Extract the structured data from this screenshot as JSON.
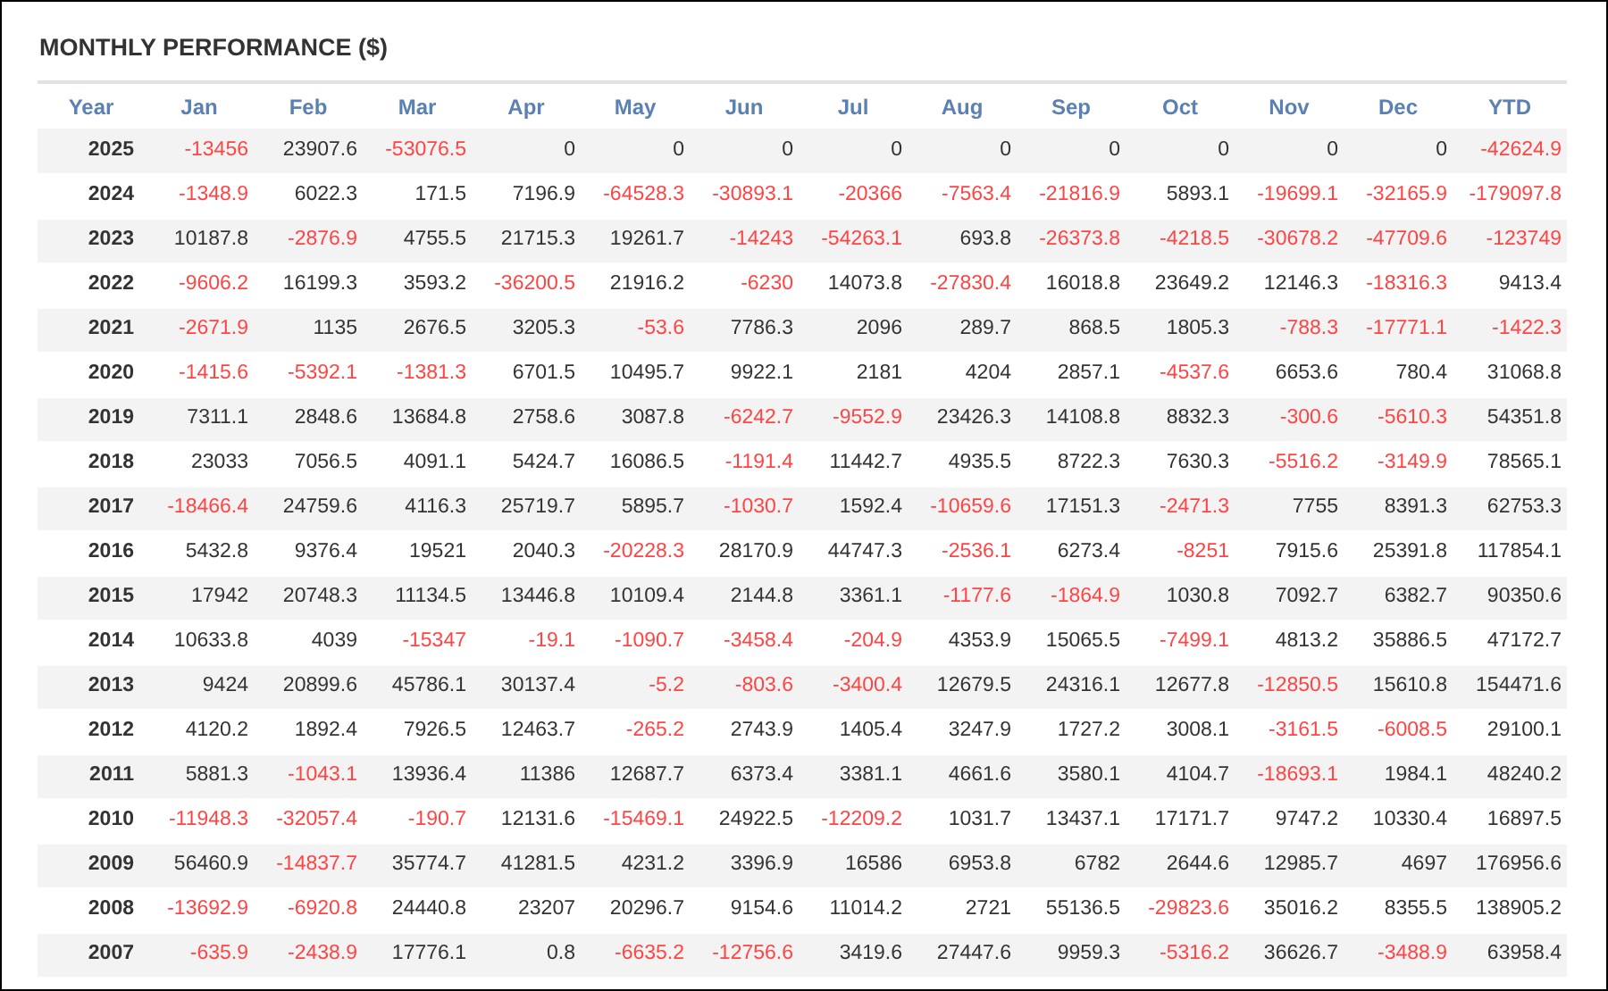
{
  "title": "MONTHLY PERFORMANCE ($)",
  "columns": [
    "Year",
    "Jan",
    "Feb",
    "Mar",
    "Apr",
    "May",
    "Jun",
    "Jul",
    "Aug",
    "Sep",
    "Oct",
    "Nov",
    "Dec",
    "YTD"
  ],
  "rows": [
    {
      "year": "2025",
      "cells": [
        {
          "value": "-13456",
          "negative": true
        },
        {
          "value": "23907.6",
          "negative": false
        },
        {
          "value": "-53076.5",
          "negative": true
        },
        {
          "value": "0",
          "negative": false
        },
        {
          "value": "0",
          "negative": false
        },
        {
          "value": "0",
          "negative": false
        },
        {
          "value": "0",
          "negative": false
        },
        {
          "value": "0",
          "negative": false
        },
        {
          "value": "0",
          "negative": false
        },
        {
          "value": "0",
          "negative": false
        },
        {
          "value": "0",
          "negative": false
        },
        {
          "value": "0",
          "negative": false
        },
        {
          "value": "-42624.9",
          "negative": true
        }
      ]
    },
    {
      "year": "2024",
      "cells": [
        {
          "value": "-1348.9",
          "negative": true
        },
        {
          "value": "6022.3",
          "negative": false
        },
        {
          "value": "171.5",
          "negative": false
        },
        {
          "value": "7196.9",
          "negative": false
        },
        {
          "value": "-64528.3",
          "negative": true
        },
        {
          "value": "-30893.1",
          "negative": true
        },
        {
          "value": "-20366",
          "negative": true
        },
        {
          "value": "-7563.4",
          "negative": true
        },
        {
          "value": "-21816.9",
          "negative": true
        },
        {
          "value": "5893.1",
          "negative": false
        },
        {
          "value": "-19699.1",
          "negative": true
        },
        {
          "value": "-32165.9",
          "negative": true
        },
        {
          "value": "-179097.8",
          "negative": true
        }
      ]
    },
    {
      "year": "2023",
      "cells": [
        {
          "value": "10187.8",
          "negative": false
        },
        {
          "value": "-2876.9",
          "negative": true
        },
        {
          "value": "4755.5",
          "negative": false
        },
        {
          "value": "21715.3",
          "negative": false
        },
        {
          "value": "19261.7",
          "negative": false
        },
        {
          "value": "-14243",
          "negative": true
        },
        {
          "value": "-54263.1",
          "negative": true
        },
        {
          "value": "693.8",
          "negative": false
        },
        {
          "value": "-26373.8",
          "negative": true
        },
        {
          "value": "-4218.5",
          "negative": true
        },
        {
          "value": "-30678.2",
          "negative": true
        },
        {
          "value": "-47709.6",
          "negative": true
        },
        {
          "value": "-123749",
          "negative": true
        }
      ]
    },
    {
      "year": "2022",
      "cells": [
        {
          "value": "-9606.2",
          "negative": true
        },
        {
          "value": "16199.3",
          "negative": false
        },
        {
          "value": "3593.2",
          "negative": false
        },
        {
          "value": "-36200.5",
          "negative": true
        },
        {
          "value": "21916.2",
          "negative": false
        },
        {
          "value": "-6230",
          "negative": true
        },
        {
          "value": "14073.8",
          "negative": false
        },
        {
          "value": "-27830.4",
          "negative": true
        },
        {
          "value": "16018.8",
          "negative": false
        },
        {
          "value": "23649.2",
          "negative": false
        },
        {
          "value": "12146.3",
          "negative": false
        },
        {
          "value": "-18316.3",
          "negative": true
        },
        {
          "value": "9413.4",
          "negative": false
        }
      ]
    },
    {
      "year": "2021",
      "cells": [
        {
          "value": "-2671.9",
          "negative": true
        },
        {
          "value": "1135",
          "negative": false
        },
        {
          "value": "2676.5",
          "negative": false
        },
        {
          "value": "3205.3",
          "negative": false
        },
        {
          "value": "-53.6",
          "negative": true
        },
        {
          "value": "7786.3",
          "negative": false
        },
        {
          "value": "2096",
          "negative": false
        },
        {
          "value": "289.7",
          "negative": false
        },
        {
          "value": "868.5",
          "negative": false
        },
        {
          "value": "1805.3",
          "negative": false
        },
        {
          "value": "-788.3",
          "negative": true
        },
        {
          "value": "-17771.1",
          "negative": true
        },
        {
          "value": "-1422.3",
          "negative": true
        }
      ]
    },
    {
      "year": "2020",
      "cells": [
        {
          "value": "-1415.6",
          "negative": true
        },
        {
          "value": "-5392.1",
          "negative": true
        },
        {
          "value": "-1381.3",
          "negative": true
        },
        {
          "value": "6701.5",
          "negative": false
        },
        {
          "value": "10495.7",
          "negative": false
        },
        {
          "value": "9922.1",
          "negative": false
        },
        {
          "value": "2181",
          "negative": false
        },
        {
          "value": "4204",
          "negative": false
        },
        {
          "value": "2857.1",
          "negative": false
        },
        {
          "value": "-4537.6",
          "negative": true
        },
        {
          "value": "6653.6",
          "negative": false
        },
        {
          "value": "780.4",
          "negative": false
        },
        {
          "value": "31068.8",
          "negative": false
        }
      ]
    },
    {
      "year": "2019",
      "cells": [
        {
          "value": "7311.1",
          "negative": false
        },
        {
          "value": "2848.6",
          "negative": false
        },
        {
          "value": "13684.8",
          "negative": false
        },
        {
          "value": "2758.6",
          "negative": false
        },
        {
          "value": "3087.8",
          "negative": false
        },
        {
          "value": "-6242.7",
          "negative": true
        },
        {
          "value": "-9552.9",
          "negative": true
        },
        {
          "value": "23426.3",
          "negative": false
        },
        {
          "value": "14108.8",
          "negative": false
        },
        {
          "value": "8832.3",
          "negative": false
        },
        {
          "value": "-300.6",
          "negative": true
        },
        {
          "value": "-5610.3",
          "negative": true
        },
        {
          "value": "54351.8",
          "negative": false
        }
      ]
    },
    {
      "year": "2018",
      "cells": [
        {
          "value": "23033",
          "negative": false
        },
        {
          "value": "7056.5",
          "negative": false
        },
        {
          "value": "4091.1",
          "negative": false
        },
        {
          "value": "5424.7",
          "negative": false
        },
        {
          "value": "16086.5",
          "negative": false
        },
        {
          "value": "-1191.4",
          "negative": true
        },
        {
          "value": "11442.7",
          "negative": false
        },
        {
          "value": "4935.5",
          "negative": false
        },
        {
          "value": "8722.3",
          "negative": false
        },
        {
          "value": "7630.3",
          "negative": false
        },
        {
          "value": "-5516.2",
          "negative": true
        },
        {
          "value": "-3149.9",
          "negative": true
        },
        {
          "value": "78565.1",
          "negative": false
        }
      ]
    },
    {
      "year": "2017",
      "cells": [
        {
          "value": "-18466.4",
          "negative": true
        },
        {
          "value": "24759.6",
          "negative": false
        },
        {
          "value": "4116.3",
          "negative": false
        },
        {
          "value": "25719.7",
          "negative": false
        },
        {
          "value": "5895.7",
          "negative": false
        },
        {
          "value": "-1030.7",
          "negative": true
        },
        {
          "value": "1592.4",
          "negative": false
        },
        {
          "value": "-10659.6",
          "negative": true
        },
        {
          "value": "17151.3",
          "negative": false
        },
        {
          "value": "-2471.3",
          "negative": true
        },
        {
          "value": "7755",
          "negative": false
        },
        {
          "value": "8391.3",
          "negative": false
        },
        {
          "value": "62753.3",
          "negative": false
        }
      ]
    },
    {
      "year": "2016",
      "cells": [
        {
          "value": "5432.8",
          "negative": false
        },
        {
          "value": "9376.4",
          "negative": false
        },
        {
          "value": "19521",
          "negative": false
        },
        {
          "value": "2040.3",
          "negative": false
        },
        {
          "value": "-20228.3",
          "negative": true
        },
        {
          "value": "28170.9",
          "negative": false
        },
        {
          "value": "44747.3",
          "negative": false
        },
        {
          "value": "-2536.1",
          "negative": true
        },
        {
          "value": "6273.4",
          "negative": false
        },
        {
          "value": "-8251",
          "negative": true
        },
        {
          "value": "7915.6",
          "negative": false
        },
        {
          "value": "25391.8",
          "negative": false
        },
        {
          "value": "117854.1",
          "negative": false
        }
      ]
    },
    {
      "year": "2015",
      "cells": [
        {
          "value": "17942",
          "negative": false
        },
        {
          "value": "20748.3",
          "negative": false
        },
        {
          "value": "11134.5",
          "negative": false
        },
        {
          "value": "13446.8",
          "negative": false
        },
        {
          "value": "10109.4",
          "negative": false
        },
        {
          "value": "2144.8",
          "negative": false
        },
        {
          "value": "3361.1",
          "negative": false
        },
        {
          "value": "-1177.6",
          "negative": true
        },
        {
          "value": "-1864.9",
          "negative": true
        },
        {
          "value": "1030.8",
          "negative": false
        },
        {
          "value": "7092.7",
          "negative": false
        },
        {
          "value": "6382.7",
          "negative": false
        },
        {
          "value": "90350.6",
          "negative": false
        }
      ]
    },
    {
      "year": "2014",
      "cells": [
        {
          "value": "10633.8",
          "negative": false
        },
        {
          "value": "4039",
          "negative": false
        },
        {
          "value": "-15347",
          "negative": true
        },
        {
          "value": "-19.1",
          "negative": true
        },
        {
          "value": "-1090.7",
          "negative": true
        },
        {
          "value": "-3458.4",
          "negative": true
        },
        {
          "value": "-204.9",
          "negative": true
        },
        {
          "value": "4353.9",
          "negative": false
        },
        {
          "value": "15065.5",
          "negative": false
        },
        {
          "value": "-7499.1",
          "negative": true
        },
        {
          "value": "4813.2",
          "negative": false
        },
        {
          "value": "35886.5",
          "negative": false
        },
        {
          "value": "47172.7",
          "negative": false
        }
      ]
    },
    {
      "year": "2013",
      "cells": [
        {
          "value": "9424",
          "negative": false
        },
        {
          "value": "20899.6",
          "negative": false
        },
        {
          "value": "45786.1",
          "negative": false
        },
        {
          "value": "30137.4",
          "negative": false
        },
        {
          "value": "-5.2",
          "negative": true
        },
        {
          "value": "-803.6",
          "negative": true
        },
        {
          "value": "-3400.4",
          "negative": true
        },
        {
          "value": "12679.5",
          "negative": false
        },
        {
          "value": "24316.1",
          "negative": false
        },
        {
          "value": "12677.8",
          "negative": false
        },
        {
          "value": "-12850.5",
          "negative": true
        },
        {
          "value": "15610.8",
          "negative": false
        },
        {
          "value": "154471.6",
          "negative": false
        }
      ]
    },
    {
      "year": "2012",
      "cells": [
        {
          "value": "4120.2",
          "negative": false
        },
        {
          "value": "1892.4",
          "negative": false
        },
        {
          "value": "7926.5",
          "negative": false
        },
        {
          "value": "12463.7",
          "negative": false
        },
        {
          "value": "-265.2",
          "negative": true
        },
        {
          "value": "2743.9",
          "negative": false
        },
        {
          "value": "1405.4",
          "negative": false
        },
        {
          "value": "3247.9",
          "negative": false
        },
        {
          "value": "1727.2",
          "negative": false
        },
        {
          "value": "3008.1",
          "negative": false
        },
        {
          "value": "-3161.5",
          "negative": true
        },
        {
          "value": "-6008.5",
          "negative": true
        },
        {
          "value": "29100.1",
          "negative": false
        }
      ]
    },
    {
      "year": "2011",
      "cells": [
        {
          "value": "5881.3",
          "negative": false
        },
        {
          "value": "-1043.1",
          "negative": true
        },
        {
          "value": "13936.4",
          "negative": false
        },
        {
          "value": "11386",
          "negative": false
        },
        {
          "value": "12687.7",
          "negative": false
        },
        {
          "value": "6373.4",
          "negative": false
        },
        {
          "value": "3381.1",
          "negative": false
        },
        {
          "value": "4661.6",
          "negative": false
        },
        {
          "value": "3580.1",
          "negative": false
        },
        {
          "value": "4104.7",
          "negative": false
        },
        {
          "value": "-18693.1",
          "negative": true
        },
        {
          "value": "1984.1",
          "negative": false
        },
        {
          "value": "48240.2",
          "negative": false
        }
      ]
    },
    {
      "year": "2010",
      "cells": [
        {
          "value": "-11948.3",
          "negative": true
        },
        {
          "value": "-32057.4",
          "negative": true
        },
        {
          "value": "-190.7",
          "negative": true
        },
        {
          "value": "12131.6",
          "negative": false
        },
        {
          "value": "-15469.1",
          "negative": true
        },
        {
          "value": "24922.5",
          "negative": false
        },
        {
          "value": "-12209.2",
          "negative": true
        },
        {
          "value": "1031.7",
          "negative": false
        },
        {
          "value": "13437.1",
          "negative": false
        },
        {
          "value": "17171.7",
          "negative": false
        },
        {
          "value": "9747.2",
          "negative": false
        },
        {
          "value": "10330.4",
          "negative": false
        },
        {
          "value": "16897.5",
          "negative": false
        }
      ]
    },
    {
      "year": "2009",
      "cells": [
        {
          "value": "56460.9",
          "negative": false
        },
        {
          "value": "-14837.7",
          "negative": true
        },
        {
          "value": "35774.7",
          "negative": false
        },
        {
          "value": "41281.5",
          "negative": false
        },
        {
          "value": "4231.2",
          "negative": false
        },
        {
          "value": "3396.9",
          "negative": false
        },
        {
          "value": "16586",
          "negative": false
        },
        {
          "value": "6953.8",
          "negative": false
        },
        {
          "value": "6782",
          "negative": false
        },
        {
          "value": "2644.6",
          "negative": false
        },
        {
          "value": "12985.7",
          "negative": false
        },
        {
          "value": "4697",
          "negative": false
        },
        {
          "value": "176956.6",
          "negative": false
        }
      ]
    },
    {
      "year": "2008",
      "cells": [
        {
          "value": "-13692.9",
          "negative": true
        },
        {
          "value": "-6920.8",
          "negative": true
        },
        {
          "value": "24440.8",
          "negative": false
        },
        {
          "value": "23207",
          "negative": false
        },
        {
          "value": "20296.7",
          "negative": false
        },
        {
          "value": "9154.6",
          "negative": false
        },
        {
          "value": "11014.2",
          "negative": false
        },
        {
          "value": "2721",
          "negative": false
        },
        {
          "value": "55136.5",
          "negative": false
        },
        {
          "value": "-29823.6",
          "negative": true
        },
        {
          "value": "35016.2",
          "negative": false
        },
        {
          "value": "8355.5",
          "negative": false
        },
        {
          "value": "138905.2",
          "negative": false
        }
      ]
    },
    {
      "year": "2007",
      "cells": [
        {
          "value": "-635.9",
          "negative": true
        },
        {
          "value": "-2438.9",
          "negative": true
        },
        {
          "value": "17776.1",
          "negative": false
        },
        {
          "value": "0.8",
          "negative": false
        },
        {
          "value": "-6635.2",
          "negative": true
        },
        {
          "value": "-12756.6",
          "negative": true
        },
        {
          "value": "3419.6",
          "negative": false
        },
        {
          "value": "27447.6",
          "negative": false
        },
        {
          "value": "9959.3",
          "negative": false
        },
        {
          "value": "-5316.2",
          "negative": true
        },
        {
          "value": "36626.7",
          "negative": false
        },
        {
          "value": "-3488.9",
          "negative": true
        },
        {
          "value": "63958.4",
          "negative": false
        }
      ]
    }
  ]
}
